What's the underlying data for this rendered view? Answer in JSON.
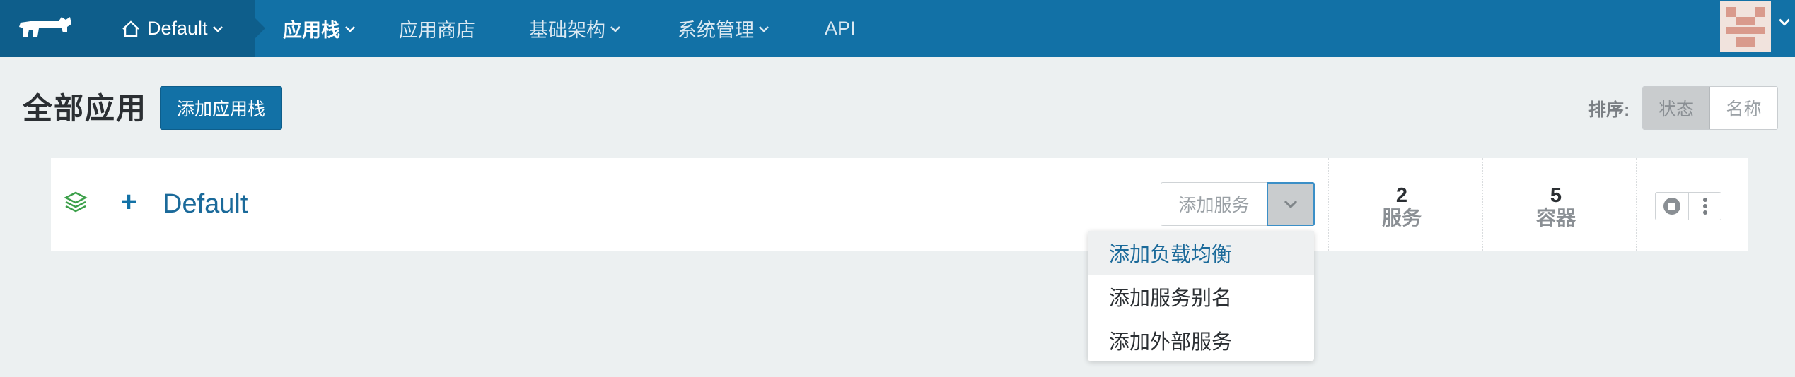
{
  "nav": {
    "environment": "Default",
    "items": [
      {
        "label": "应用栈",
        "dropdown": true,
        "active": true
      },
      {
        "label": "应用商店",
        "dropdown": false,
        "active": false
      },
      {
        "label": "基础架构",
        "dropdown": true,
        "active": false
      },
      {
        "label": "系统管理",
        "dropdown": true,
        "active": false
      },
      {
        "label": "API",
        "dropdown": false,
        "active": false
      }
    ]
  },
  "header": {
    "title": "全部应用",
    "add_stack_label": "添加应用栈",
    "sort_label": "排序:",
    "sort_options": [
      "状态",
      "名称"
    ],
    "sort_selected": "状态"
  },
  "stack": {
    "name": "Default",
    "add_service_label": "添加服务",
    "services_count": "2",
    "services_label": "服务",
    "containers_count": "5",
    "containers_label": "容器"
  },
  "dropdown": {
    "items": [
      "添加负载均衡",
      "添加服务别名",
      "添加外部服务"
    ],
    "highlighted_index": 0
  },
  "colors": {
    "nav_bg": "#1271a6",
    "nav_dark": "#0e5e8b",
    "accent": "#1271a6",
    "stack_icon": "#3ca04a"
  }
}
